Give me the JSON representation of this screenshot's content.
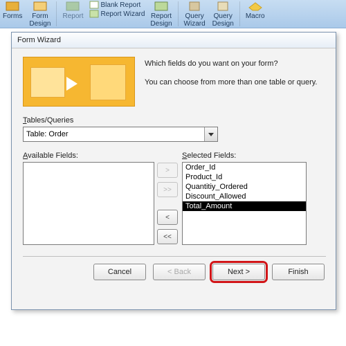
{
  "ribbon": {
    "items": [
      {
        "label": "Forms"
      },
      {
        "label": "Form\nDesign"
      },
      {
        "label": "Report"
      },
      {
        "label": "Blank Report"
      },
      {
        "label": "Report Wizard"
      },
      {
        "label": "Report\nDesign"
      },
      {
        "label": "Query\nWizard"
      },
      {
        "label": "Query\nDesign"
      },
      {
        "label": "Macro"
      }
    ]
  },
  "dialog": {
    "title": "Form Wizard",
    "prompt1": "Which fields do you want on your form?",
    "prompt2": "You can choose from more than one table or query.",
    "tables_queries_label": "Tables/Queries",
    "tables_queries_value": "Table: Order",
    "available_label": "Available Fields:",
    "selected_label": "Selected Fields:",
    "available_fields": [],
    "selected_fields": [
      "Order_Id",
      "Product_Id",
      "Quantitiy_Ordered",
      "Discount_Allowed",
      "Total_Amount"
    ],
    "selected_index": 4,
    "move": {
      "add": ">",
      "add_all": ">>",
      "remove": "<",
      "remove_all": "<<"
    },
    "buttons": {
      "cancel": "Cancel",
      "back": "< Back",
      "next": "Next >",
      "finish": "Finish"
    }
  }
}
